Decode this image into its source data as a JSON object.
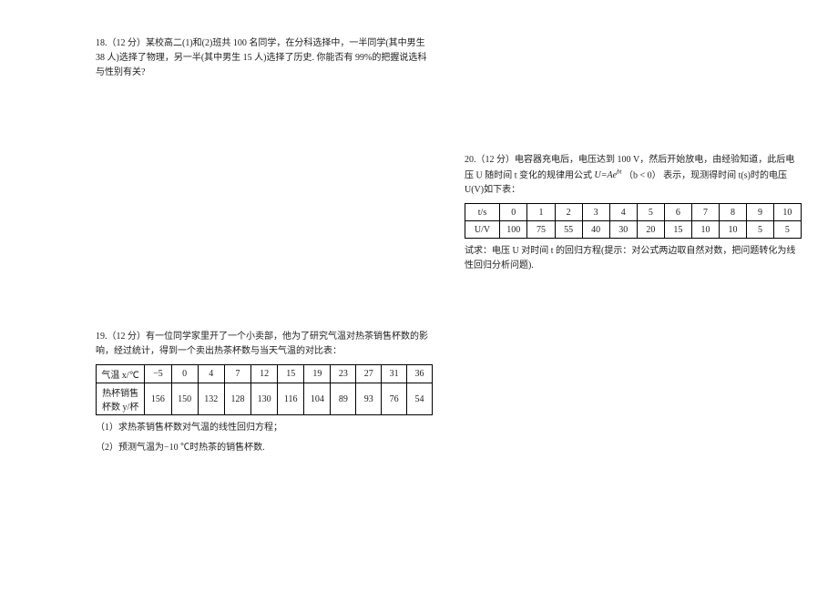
{
  "q18": {
    "text": "18.（12 分）某校高二(1)和(2)班共 100 名同学，在分科选择中，一半同学(其中男生 38 人)选择了物理，另一半(其中男生 15 人)选择了历史. 你能否有 99%的把握说选科与性别有关?"
  },
  "q19": {
    "intro1": "19.（12 分）有一位同学家里开了一个小卖部，他为了研究气温对热茶销售杯数的影响，经过统计，得到一个卖出热茶杯数与当天气温的对比表：",
    "row1_label": "气温 x/℃",
    "row2_label": "热杯销售杯数 y/杯",
    "r1": [
      "−5",
      "0",
      "4",
      "7",
      "12",
      "15",
      "19",
      "23",
      "27",
      "31",
      "36"
    ],
    "r2": [
      "156",
      "150",
      "132",
      "128",
      "130",
      "116",
      "104",
      "89",
      "93",
      "76",
      "54"
    ],
    "sub1": "（1）求热茶销售杯数对气温的线性回归方程；",
    "sub2": "（2）预测气温为−10 ℃时热茶的销售杯数."
  },
  "q20": {
    "intro_a": "20.（12 分）电容器充电后，电压达到 100 V，然后开始放电，由经验知道，此后电压 U 随时间 t 变化的规律用公式",
    "intro_b": "表示，现测得时间 t(s)时的电压 U(V)如下表：",
    "formula_pre": "U=Ae",
    "formula_exp": "bt",
    "formula_post": "（b < 0）",
    "row1_label": "t/s",
    "row2_label": "U/V",
    "r1": [
      "0",
      "1",
      "2",
      "3",
      "4",
      "5",
      "6",
      "7",
      "8",
      "9",
      "10"
    ],
    "r2": [
      "100",
      "75",
      "55",
      "40",
      "30",
      "20",
      "15",
      "10",
      "10",
      "5",
      "5"
    ],
    "outro": "试求：电压 U 对时间 t 的回归方程(提示：对公式两边取自然对数，把问题转化为线性回归分析问题)."
  },
  "chart_data": [
    {
      "type": "table",
      "title": "Q19 气温与热茶销售杯数",
      "categories": [
        -5,
        0,
        4,
        7,
        12,
        15,
        19,
        23,
        27,
        31,
        36
      ],
      "values": [
        156,
        150,
        132,
        128,
        130,
        116,
        104,
        89,
        93,
        76,
        54
      ],
      "xlabel": "气温 x/℃",
      "ylabel": "热杯销售杯数 y/杯"
    },
    {
      "type": "table",
      "title": "Q20 时间与电压",
      "categories": [
        0,
        1,
        2,
        3,
        4,
        5,
        6,
        7,
        8,
        9,
        10
      ],
      "values": [
        100,
        75,
        55,
        40,
        30,
        20,
        15,
        10,
        10,
        5,
        5
      ],
      "xlabel": "t/s",
      "ylabel": "U/V"
    }
  ]
}
